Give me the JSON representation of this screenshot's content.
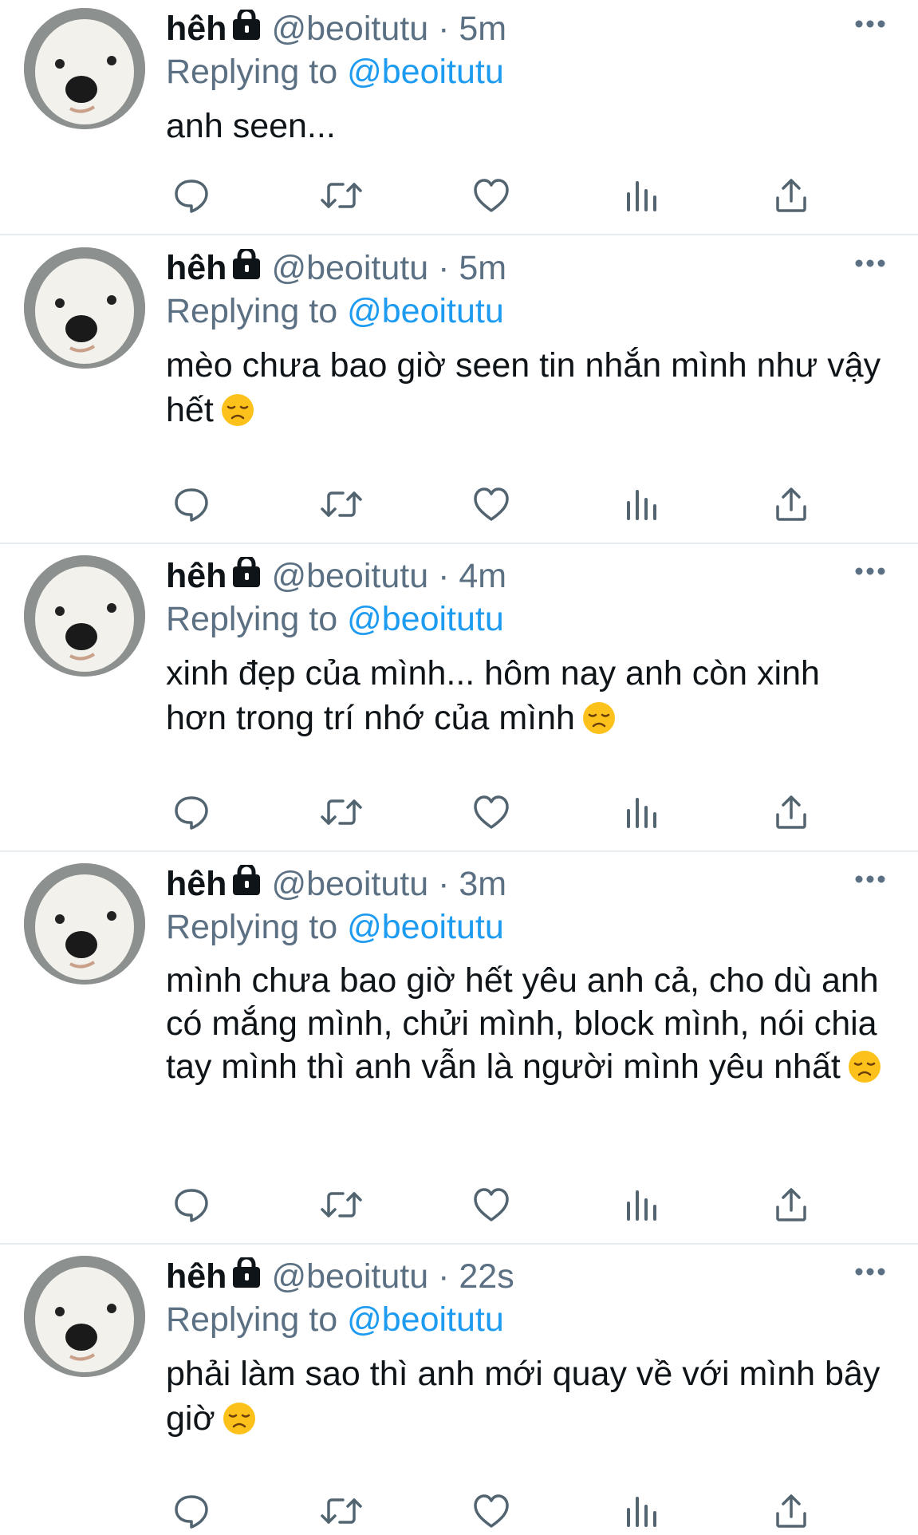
{
  "tweets": [
    {
      "name": "hêh",
      "handle": "@beoitutu",
      "separator": "·",
      "time": "5m",
      "replying_prefix": "Replying to",
      "replying_to": "@beoitutu",
      "text": "anh seen...",
      "emoji": ""
    },
    {
      "name": "hêh",
      "handle": "@beoitutu",
      "separator": "·",
      "time": "5m",
      "replying_prefix": "Replying to",
      "replying_to": "@beoitutu",
      "text": "mèo chưa bao giờ seen tin nhắn mình như vậy hết",
      "emoji": "disappointed-face"
    },
    {
      "name": "hêh",
      "handle": "@beoitutu",
      "separator": "·",
      "time": "4m",
      "replying_prefix": "Replying to",
      "replying_to": "@beoitutu",
      "text": "xinh đẹp của mình... hôm nay anh còn xinh hơn trong trí nhớ của mình",
      "emoji": "disappointed-face"
    },
    {
      "name": "hêh",
      "handle": "@beoitutu",
      "separator": "·",
      "time": "3m",
      "replying_prefix": "Replying to",
      "replying_to": "@beoitutu",
      "text": "mình chưa bao giờ hết yêu anh cả, cho dù anh có mắng mình, chửi mình, block mình, nói chia tay mình thì anh vẫn là người mình yêu nhất",
      "emoji": "disappointed-face"
    },
    {
      "name": "hêh",
      "handle": "@beoitutu",
      "separator": "·",
      "time": "22s",
      "replying_prefix": "Replying to",
      "replying_to": "@beoitutu",
      "text": "phải làm sao thì anh mới quay về với mình bây giờ",
      "emoji": "disappointed-face"
    }
  ],
  "icons": {
    "reply": "reply-icon",
    "retweet": "retweet-icon",
    "like": "heart-icon",
    "analytics": "analytics-icon",
    "share": "share-icon",
    "more": "more-icon",
    "protected": "lock-icon"
  },
  "colors": {
    "link": "#1d9bf0",
    "secondary_text": "#5b7083",
    "divider": "#e6ecf0",
    "icon": "#536471"
  }
}
